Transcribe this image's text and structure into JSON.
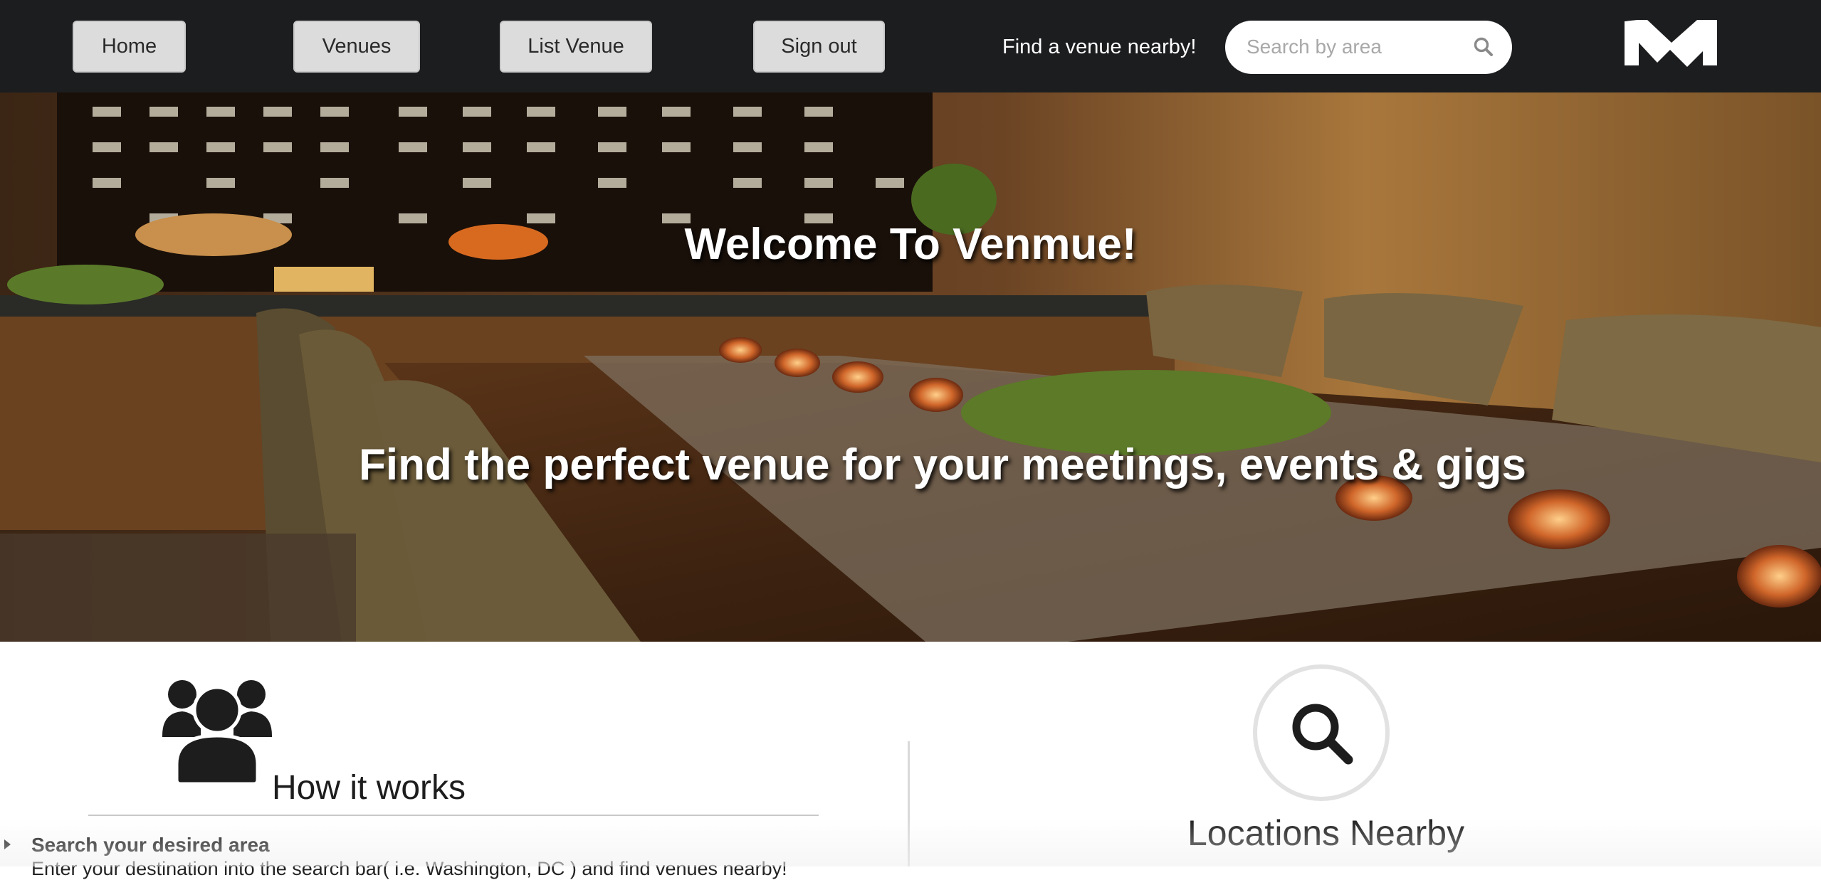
{
  "nav": {
    "items": [
      {
        "label": "Home"
      },
      {
        "label": "Venues"
      },
      {
        "label": "List Venue"
      },
      {
        "label": "Sign out"
      }
    ],
    "tagline": "Find a venue nearby!",
    "search": {
      "placeholder": "Search by area",
      "value": "",
      "icon": "search-icon"
    },
    "logo_icon": "venmue-logo"
  },
  "hero": {
    "title": "Welcome To Venmue!",
    "subtitle": "Find the perfect venue for your meetings, events & gigs"
  },
  "how_it_works": {
    "icon": "users-icon",
    "title": "How it works",
    "steps": [
      {
        "title": "Search your desired area",
        "description": "Enter your destination into the search bar( i.e. Washington, DC ) and find venues nearby!"
      }
    ]
  },
  "locations": {
    "icon": "search-icon",
    "title": "Locations Nearby"
  },
  "colors": {
    "nav_bg": "#1c1d1f",
    "button_bg": "#dcdcdc",
    "text_dark": "#1d1d1d",
    "hero_text": "#ffffff"
  }
}
